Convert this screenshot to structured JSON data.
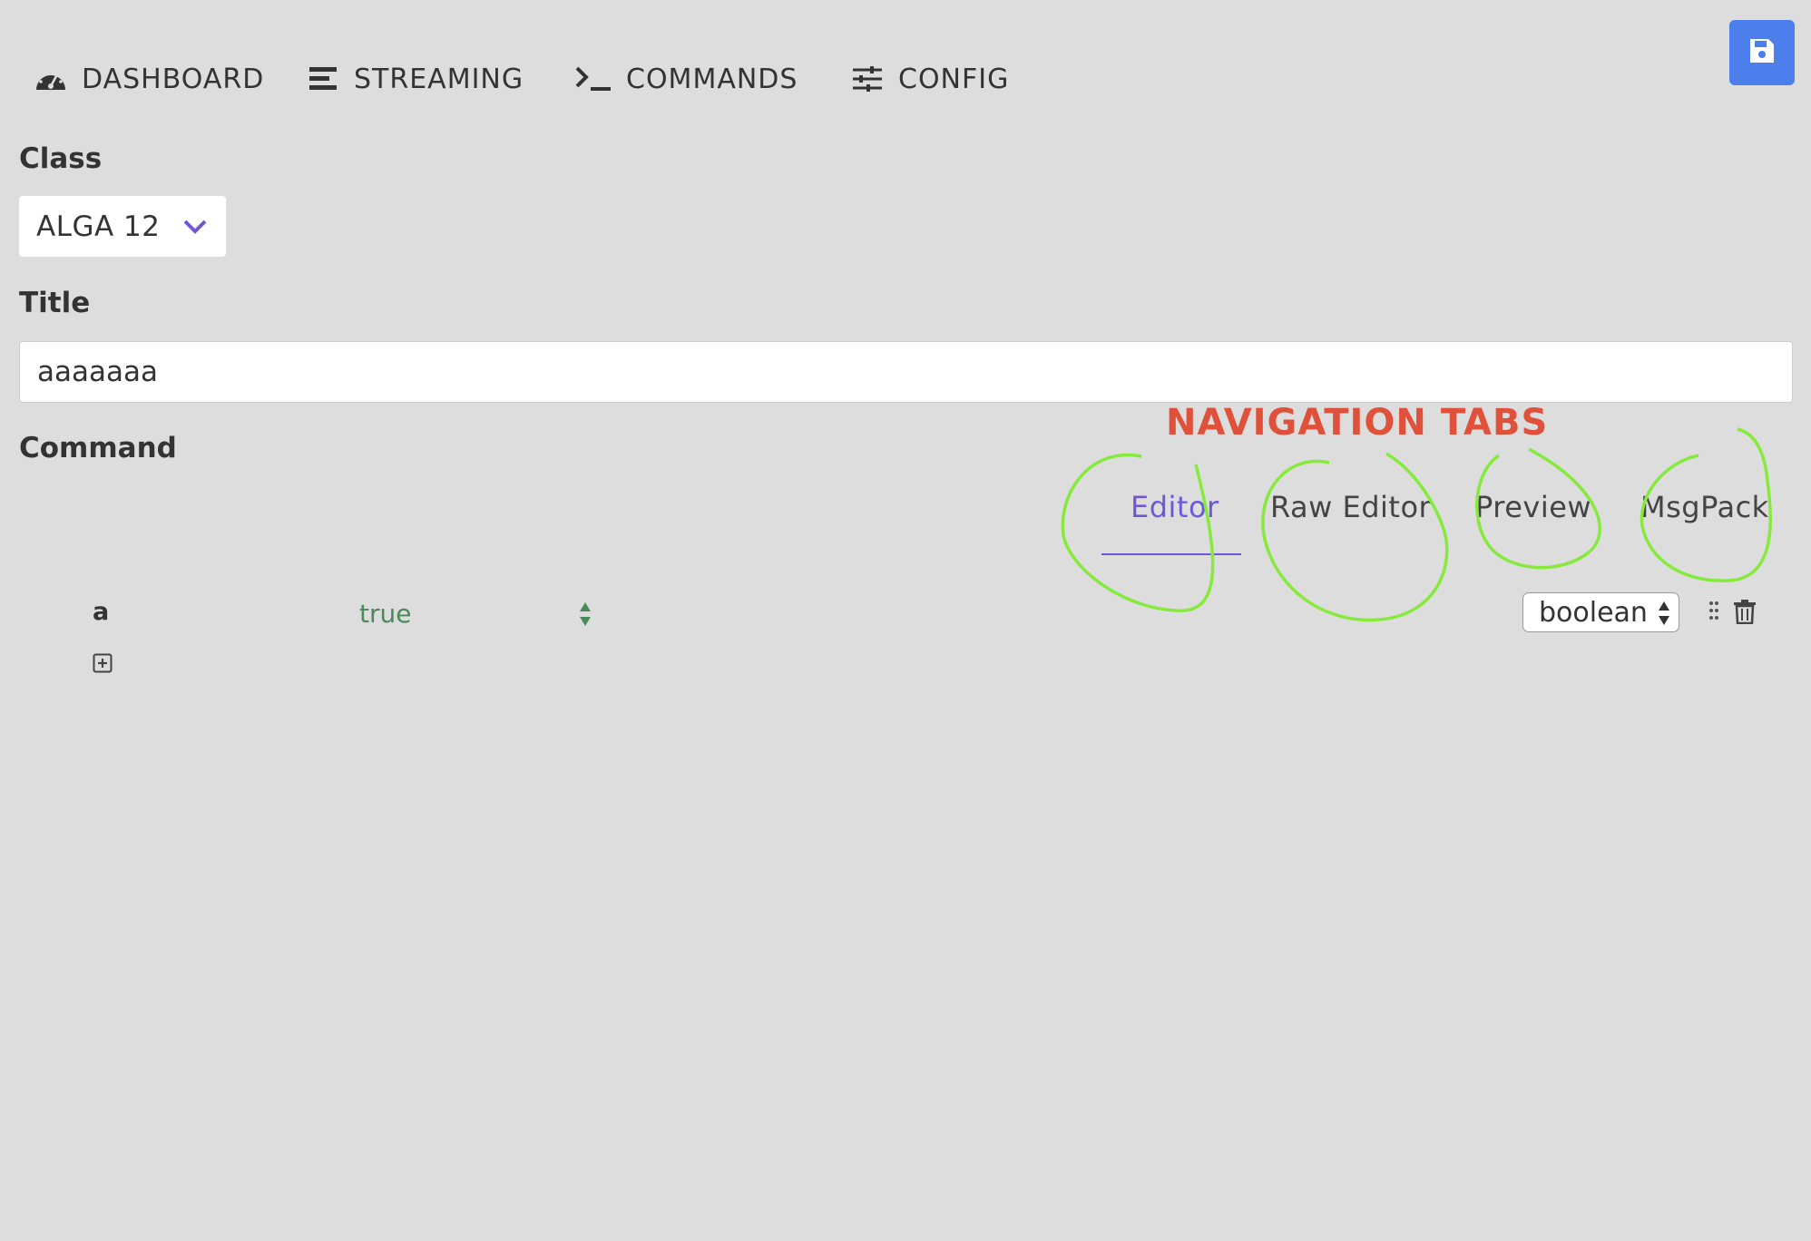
{
  "nav": {
    "items": [
      {
        "label": "DASHBOARD",
        "icon": "dashboard-gauge-icon"
      },
      {
        "label": "STREAMING",
        "icon": "streaming-bars-icon"
      },
      {
        "label": "COMMANDS",
        "icon": "terminal-prompt-icon"
      },
      {
        "label": "CONFIG",
        "icon": "sliders-icon"
      }
    ],
    "save_icon": "save-floppy-icon",
    "save_button_color": "#4c7fec"
  },
  "form": {
    "class_label": "Class",
    "class_value": "ALGA 12",
    "title_label": "Title",
    "title_value": "aaaaaaa",
    "command_label": "Command"
  },
  "annotation": {
    "title": "NAVIGATION TABS",
    "title_color": "#e0513b",
    "circle_color": "#86ea3c"
  },
  "tabs": [
    {
      "label": "Editor",
      "active": true
    },
    {
      "label": "Raw Editor",
      "active": false
    },
    {
      "label": "Preview",
      "active": false
    },
    {
      "label": "MsgPack",
      "active": false
    }
  ],
  "accent_color": "#6e58d6",
  "editor": {
    "rows": [
      {
        "key": "a",
        "value": "true",
        "type": "boolean"
      }
    ],
    "value_color": "#4a8a5a"
  }
}
